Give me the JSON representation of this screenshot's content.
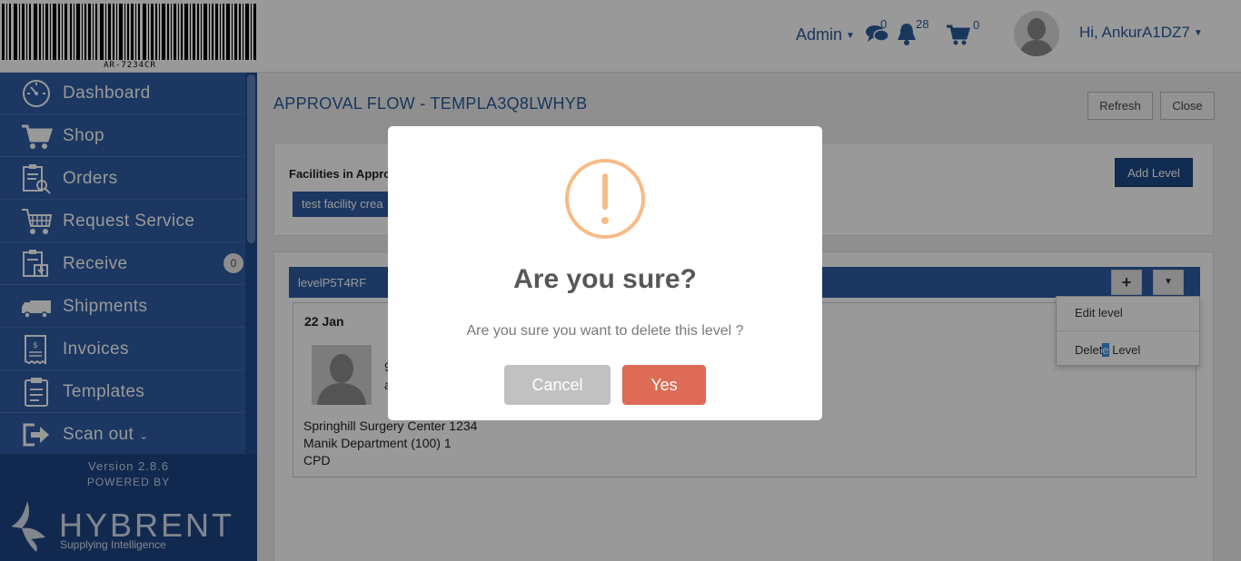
{
  "header": {
    "barcode_text": "AR-7234CR",
    "admin_label": "Admin",
    "messages_count": "0",
    "notifications_count": "28",
    "cart_count": "0",
    "greeting": "Hi, AnkurA1DZ7"
  },
  "sidebar": {
    "items": [
      {
        "label": "Dashboard",
        "icon": "dashboard-icon"
      },
      {
        "label": "Shop",
        "icon": "cart-icon"
      },
      {
        "label": "Orders",
        "icon": "orders-icon"
      },
      {
        "label": "Request Service",
        "icon": "request-service-icon"
      },
      {
        "label": "Receive",
        "icon": "receive-icon",
        "badge": "0"
      },
      {
        "label": "Shipments",
        "icon": "truck-icon"
      },
      {
        "label": "Invoices",
        "icon": "invoice-icon"
      },
      {
        "label": "Templates",
        "icon": "clipboard-icon"
      },
      {
        "label": "Scan out",
        "icon": "sign-out-icon"
      }
    ],
    "version": "Version 2.8.6",
    "powered_by": "POWERED BY",
    "logo_word": "HYBRENT",
    "logo_tagline": "Supplying Intelligence"
  },
  "main": {
    "title": "APPROVAL FLOW - TEMPLA3Q8LWHYB",
    "refresh_label": "Refresh",
    "close_label": "Close",
    "facilities_label": "Facilities in Appro",
    "facility_chip": "test facility crea",
    "add_level_label": "Add Level",
    "level": {
      "name": "levelP5T4RF",
      "add_symbol": "+",
      "date": "22 Jan",
      "person_line1": "9",
      "person_line2": "a",
      "address_line1": "Springhill Surgery Center 1234",
      "address_line2": "Manik Department (100) 1",
      "address_line3": "CPD"
    }
  },
  "dropdown": {
    "edit_level": "Edit level",
    "delete_level_pre": "Delet",
    "delete_level_highlight": "e",
    "delete_level_post": " Level"
  },
  "modal": {
    "title": "Are you sure?",
    "text": "Are you sure you want to delete this level ?",
    "cancel_label": "Cancel",
    "yes_label": "Yes",
    "cancel_color": "#c1c1c1",
    "yes_color": "#dd6b55",
    "warning_color": "#f8bb86"
  }
}
